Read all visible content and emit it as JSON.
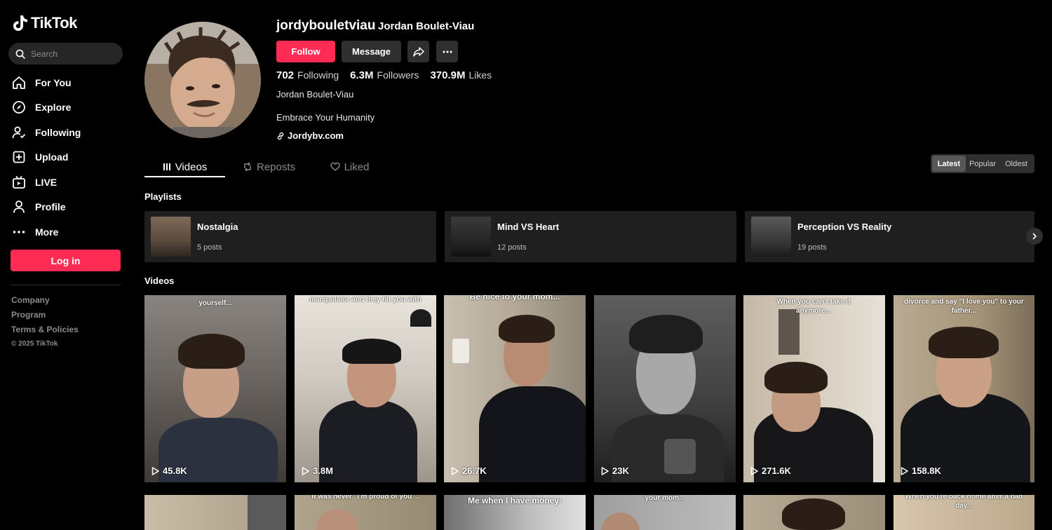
{
  "sidebar": {
    "logo": "TikTok",
    "search_placeholder": "Search",
    "nav": [
      {
        "label": "For You",
        "icon": "home-icon"
      },
      {
        "label": "Explore",
        "icon": "compass-icon"
      },
      {
        "label": "Following",
        "icon": "following-icon"
      },
      {
        "label": "Upload",
        "icon": "upload-icon"
      },
      {
        "label": "LIVE",
        "icon": "live-icon"
      },
      {
        "label": "Profile",
        "icon": "profile-icon"
      },
      {
        "label": "More",
        "icon": "more-icon"
      }
    ],
    "login_label": "Log in",
    "footer_links": [
      "Company",
      "Program",
      "Terms & Policies"
    ],
    "copyright": "© 2025 TikTok"
  },
  "profile": {
    "username": "jordybouletviau",
    "display_name": "Jordan Boulet-Viau",
    "follow_label": "Follow",
    "message_label": "Message",
    "following_count": "702",
    "following_label": "Following",
    "followers_count": "6.3M",
    "followers_label": "Followers",
    "likes_count": "370.9M",
    "likes_label": "Likes",
    "bio_name": "Jordan Boulet-Viau",
    "bio": "Embrace Your Humanity",
    "link": "Jordybv.com"
  },
  "tabs": [
    {
      "label": "Videos",
      "icon": "grid-icon"
    },
    {
      "label": "Reposts",
      "icon": "repost-icon"
    },
    {
      "label": "Liked",
      "icon": "heart-icon"
    }
  ],
  "sort": {
    "latest": "Latest",
    "popular": "Popular",
    "oldest": "Oldest"
  },
  "playlists_title": "Playlists",
  "playlists": [
    {
      "title": "Nostalgia",
      "count": "5 posts"
    },
    {
      "title": "Mind VS Heart",
      "count": "12 posts"
    },
    {
      "title": "Perception VS Reality",
      "count": "19 posts"
    }
  ],
  "videos_title": "Videos",
  "videos": [
    {
      "caption": "yourself...",
      "views": "45.8K"
    },
    {
      "caption": "manipulator and they hit you with",
      "views": "3.8M"
    },
    {
      "caption": "Be nice to your mom...",
      "views": "26.7K"
    },
    {
      "caption": "",
      "views": "23K"
    },
    {
      "caption": "When you can't take it anymore...",
      "views": "271.6K"
    },
    {
      "caption": "divorce and say \"I love you\" to your father...",
      "views": "158.8K"
    }
  ],
  "videos_row2": [
    {
      "caption": ""
    },
    {
      "caption": "It was never \"I'm proud of you\".."
    },
    {
      "caption": "Me when I have money:"
    },
    {
      "caption": "your mom..."
    },
    {
      "caption": ""
    },
    {
      "caption": "When you're back home after a bad day..."
    }
  ]
}
